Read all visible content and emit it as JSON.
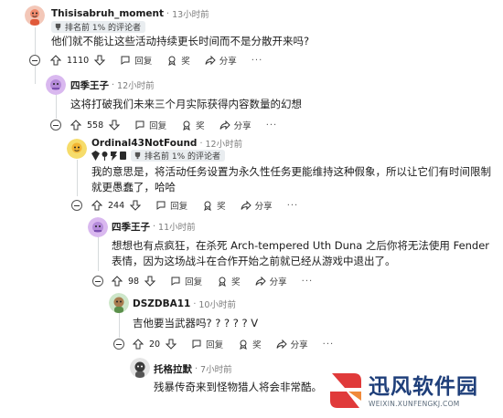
{
  "comments": [
    {
      "username": "Thisisabruh_moment",
      "time": "13小时前",
      "flair": "排名前 1% 的评论者",
      "text": "他们就不能让这些活动持续更长时间而不是分散开来吗?",
      "votes": "1110",
      "actions": {
        "reply": "回复",
        "award": "奖",
        "share": "分享"
      }
    },
    {
      "username": "四季王子",
      "time": "12小时前",
      "text": "这将打破我们未来三个月实际获得内容数量的幻想",
      "votes": "558",
      "actions": {
        "reply": "回复",
        "award": "奖",
        "share": "分享"
      }
    },
    {
      "username": "Ordinal43NotFound",
      "time": "12小时前",
      "flair": "排名前 1% 的评论者",
      "text": "我的意思是，将活动任务设置为永久性任务更能维持这种假象，所以让它们有时间限制就更愚蠢了，哈哈",
      "votes": "244",
      "actions": {
        "reply": "回复",
        "award": "奖",
        "share": "分享"
      }
    },
    {
      "username": "四季王子",
      "time": "11小时前",
      "text": "想想也有点疯狂，在杀死 Arch-tempered Uth Duna 之后你将无法使用 Fender 表情，因为这场战斗在合作开始之前就已经从游戏中退出了。",
      "votes": "98",
      "actions": {
        "reply": "回复",
        "award": "奖",
        "share": "分享"
      }
    },
    {
      "username": "DSZDBA11",
      "time": "10小时前",
      "text": "吉他要当武器吗? ? ? ? ? V",
      "votes": "20",
      "actions": {
        "reply": "回复",
        "award": "奖",
        "share": "分享"
      }
    },
    {
      "username": "托格拉默",
      "time": "7小时前",
      "text": "残暴传奇来到怪物猎人将会非常酷。"
    }
  ],
  "more_label": "···",
  "watermark": {
    "title": "迅风软件园",
    "url": "WEIXIN.XUNFENGKJ.COM"
  },
  "colors": {
    "text": "#1c1c1c",
    "meta": "#7c7c7c",
    "flair_bg": "#e9edf0",
    "thread_line": "#d6dadc",
    "watermark_blue": "#1f3f7a",
    "watermark_red": "#e03a3a"
  }
}
